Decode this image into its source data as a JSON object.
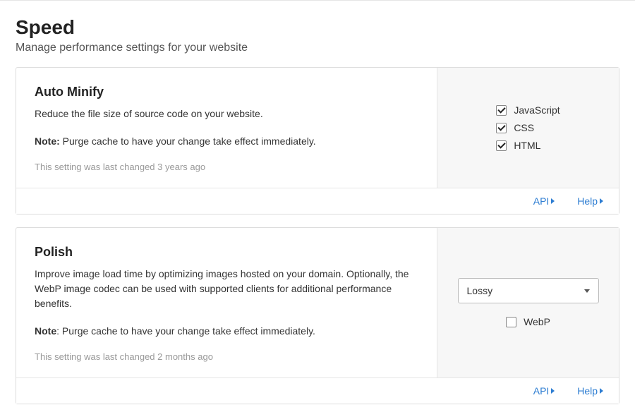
{
  "page": {
    "title": "Speed",
    "subtitle": "Manage performance settings for your website"
  },
  "cards": {
    "auto_minify": {
      "title": "Auto Minify",
      "description": "Reduce the file size of source code on your website.",
      "note_label": "Note:",
      "note_text": " Purge cache to have your change take effect immediately.",
      "meta": "This setting was last changed 3 years ago",
      "options": {
        "javascript": {
          "label": "JavaScript",
          "checked": true
        },
        "css": {
          "label": "CSS",
          "checked": true
        },
        "html": {
          "label": "HTML",
          "checked": true
        }
      }
    },
    "polish": {
      "title": "Polish",
      "description": "Improve image load time by optimizing images hosted on your domain. Optionally, the WebP image codec can be used with supported clients for additional performance benefits.",
      "note_label": "Note",
      "note_text": ": Purge cache to have your change take effect immediately.",
      "meta": "This setting was last changed 2 months ago",
      "select_value": "Lossy",
      "webp": {
        "label": "WebP",
        "checked": false
      }
    }
  },
  "footer": {
    "api": "API",
    "help": "Help"
  }
}
